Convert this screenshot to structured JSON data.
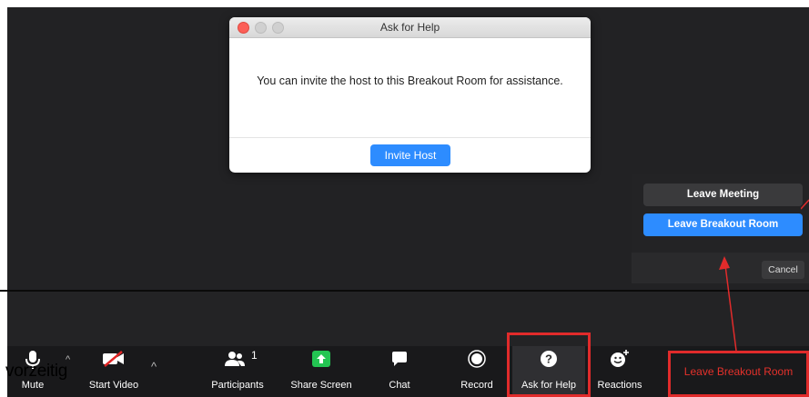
{
  "dialog": {
    "title": "Ask for Help",
    "message": "You can invite the host to this Breakout Room for assistance.",
    "button": "Invite Host"
  },
  "leave_panel": {
    "leave_meeting": "Leave Meeting",
    "leave_breakout": "Leave Breakout Room",
    "cancel": "Cancel"
  },
  "toolbar": {
    "mute": "Mute",
    "start_video": "Start Video",
    "participants": "Participants",
    "participants_count": "1",
    "share_screen": "Share Screen",
    "chat": "Chat",
    "record": "Record",
    "ask_for_help": "Ask for Help",
    "reactions": "Reactions",
    "leave_breakout_room": "Leave Breakout Room"
  },
  "overlay": {
    "caption": "vorzeitig"
  },
  "colors": {
    "accent": "#2d8cff",
    "highlight": "#e12b2b",
    "toolbar_bg": "#19191b"
  }
}
